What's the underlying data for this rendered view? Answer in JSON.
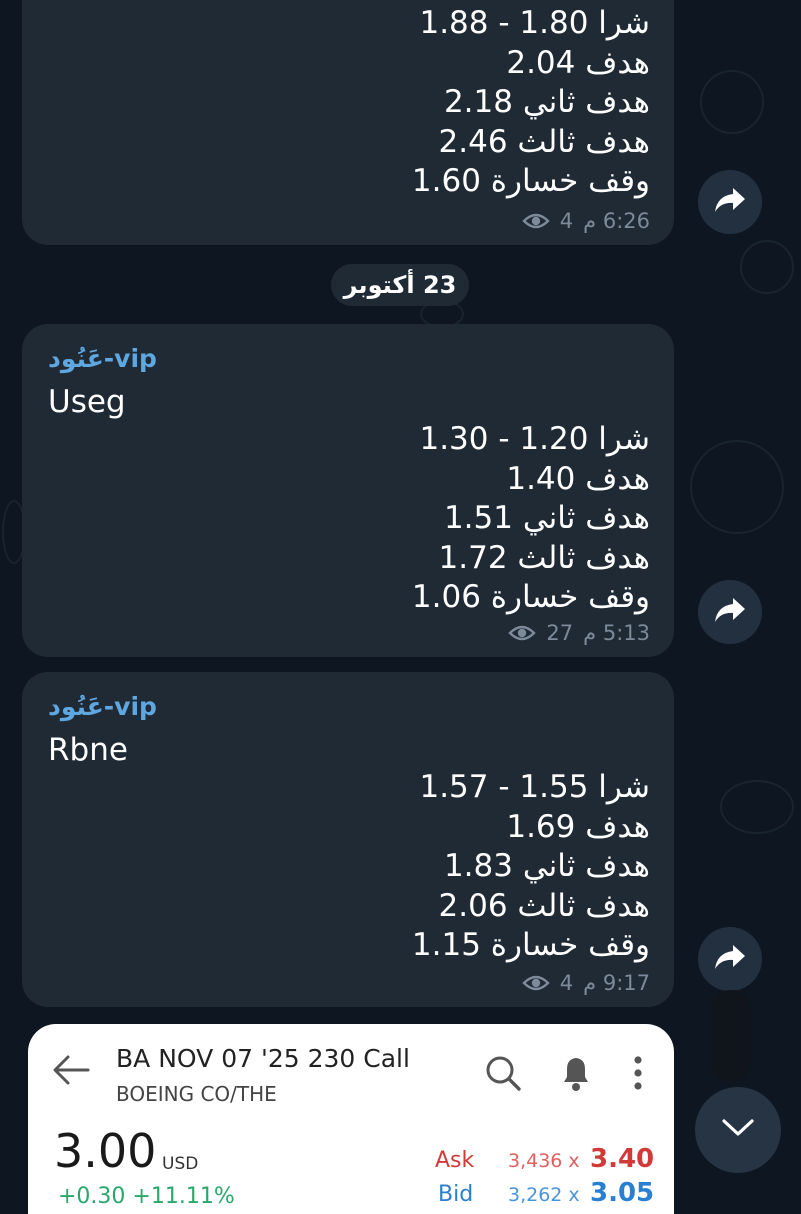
{
  "chat": {
    "date_separator": "23 أكتوبر",
    "messages": [
      {
        "sender": "",
        "ticker": "",
        "lines": [
          "شرا 1.80 - 1.88",
          "هدف 2.04",
          "هدف ثاني 2.18",
          "هدف ثالث 2.46",
          "وقف خسارة 1.60"
        ],
        "time": "6:26 م",
        "views": "4"
      },
      {
        "sender": "عَنُود-vip",
        "ticker": "Useg",
        "lines": [
          "شرا 1.20 - 1.30",
          "هدف 1.40",
          "هدف ثاني 1.51",
          "هدف ثالث 1.72",
          "وقف خسارة 1.06"
        ],
        "time": "5:13 م",
        "views": "27"
      },
      {
        "sender": "عَنُود-vip",
        "ticker": "Rbne",
        "lines": [
          "شرا 1.55 - 1.57",
          "هدف 1.69",
          "هدف ثاني 1.83",
          "هدف ثالث 2.06",
          "وقف خسارة 1.15"
        ],
        "time": "9:17 م",
        "views": "4"
      }
    ]
  },
  "card": {
    "title": "BA NOV 07 '25 230 Call",
    "subtitle": "BOEING CO/THE",
    "price": "3.00",
    "currency": "USD",
    "ask_label": "Ask",
    "ask_size": "3,436 x",
    "ask_price": "3.40",
    "bid_label": "Bid",
    "bid_size": "3,262 x",
    "bid_price": "3.05",
    "change": "+0.30  +11.11%"
  },
  "icons": [
    "eye-icon",
    "forward-icon",
    "back-arrow-icon",
    "search-icon",
    "bell-icon",
    "more-vertical-icon",
    "chevron-down-icon"
  ],
  "colors": {
    "background": "#0e1621",
    "bubble": "#1f2a35",
    "sender": "#5fa7e0",
    "meta": "#7d8a99",
    "ask": "#d23a3a",
    "bid": "#2a7fd0"
  }
}
